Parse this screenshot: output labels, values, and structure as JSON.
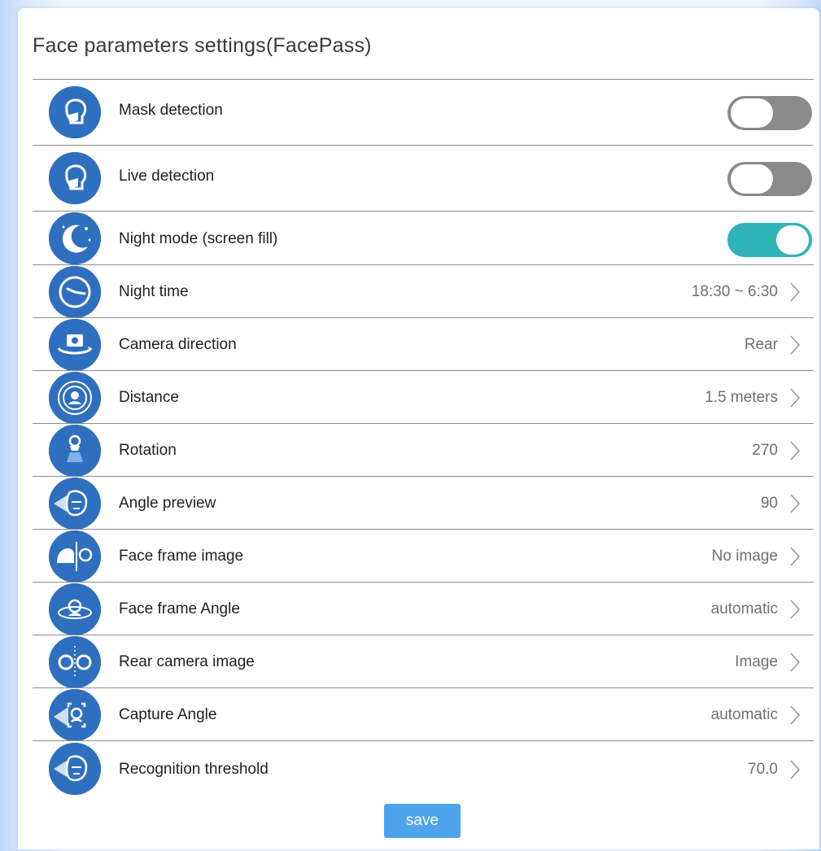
{
  "page": {
    "title": "Face parameters settings(FacePass)"
  },
  "colors": {
    "icon_bg": "#2f6fbf",
    "toggle_on": "#2fb3b7",
    "toggle_off": "#8a8a8a",
    "save_bg": "#4da4ec"
  },
  "rows": [
    {
      "label": "Mask detection",
      "icon": "mask-face-icon",
      "control": "toggle",
      "on": false
    },
    {
      "label": "Live detection",
      "icon": "mask-face-icon",
      "control": "toggle",
      "on": false
    },
    {
      "label": "Night mode (screen fill)",
      "icon": "moon-icon",
      "control": "toggle",
      "on": true
    },
    {
      "label": "Night time",
      "icon": "clock-icon",
      "control": "value",
      "value": "18:30 ~ 6:30"
    },
    {
      "label": "Camera direction",
      "icon": "camera-rotate-icon",
      "control": "value",
      "value": "Rear"
    },
    {
      "label": "Distance",
      "icon": "face-target-icon",
      "control": "value",
      "value": "1.5 meters"
    },
    {
      "label": "Rotation",
      "icon": "rotation-icon",
      "control": "value",
      "value": "270"
    },
    {
      "label": "Angle preview",
      "icon": "face-angle-icon",
      "control": "value",
      "value": "90"
    },
    {
      "label": "Face frame image",
      "icon": "face-frame-icon",
      "control": "value",
      "value": "No image"
    },
    {
      "label": "Face frame Angle",
      "icon": "face-orbit-icon",
      "control": "value",
      "value": "automatic"
    },
    {
      "label": "Rear camera image",
      "icon": "dual-camera-icon",
      "control": "value",
      "value": "Image"
    },
    {
      "label": "Capture Angle",
      "icon": "capture-face-icon",
      "control": "value",
      "value": "automatic"
    },
    {
      "label": "Recognition threshold",
      "icon": "face-angle-icon",
      "control": "value",
      "value": "70.0"
    }
  ],
  "save": {
    "label": "save"
  }
}
